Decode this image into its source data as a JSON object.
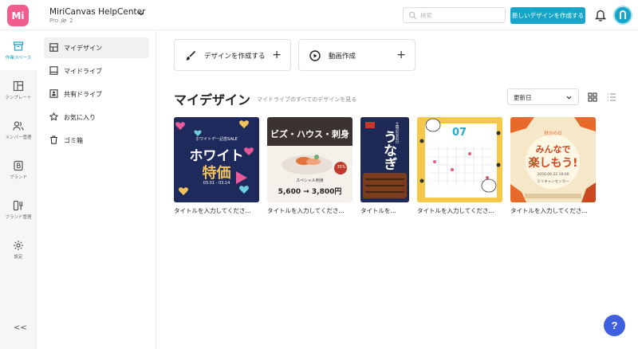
{
  "header": {
    "logo_text": "Mi",
    "workspace_name": "MiriCanvas HelpCenter",
    "workspace_plan": "Pro",
    "member_count": "2",
    "search_placeholder": "検索",
    "create_button": "新しいデザインを作成する"
  },
  "rail": {
    "items": [
      {
        "label": "作業スペース",
        "icon": "workspace-icon"
      },
      {
        "label": "テンプレート",
        "icon": "template-icon"
      },
      {
        "label": "メンバー管理",
        "icon": "members-icon"
      },
      {
        "label": "ブランド",
        "icon": "brand-icon"
      },
      {
        "label": "ブランド管理",
        "icon": "brand-manage-icon"
      },
      {
        "label": "設定",
        "icon": "settings-icon"
      }
    ],
    "collapse": "<<"
  },
  "folders": {
    "items": [
      {
        "label": "マイデザイン"
      },
      {
        "label": "マイドライブ"
      },
      {
        "label": "共有ドライブ"
      },
      {
        "label": "お気に入り"
      },
      {
        "label": "ゴミ箱"
      }
    ]
  },
  "quick_actions": {
    "create_design": "デザインを作成する",
    "video_create": "動画作成",
    "plus": "+"
  },
  "section": {
    "title": "マイデザイン",
    "subtitle": "マイドライブのすべてのデザインを見る",
    "sort_value": "更新日"
  },
  "designs": [
    {
      "title": "タイトルを入力してくださ...",
      "thumb_text_1": "ホワイトデー記念SALE",
      "thumb_text_2": "ホワイト",
      "thumb_text_3": "特価",
      "thumb_text_4": "03.01 - 03.14"
    },
    {
      "title": "タイトルを入力してくださ...",
      "thumb_text_1": "ビズ・ハウス・刺身",
      "thumb_text_2": "スペシャル刺身",
      "thumb_text_3": "5,600 → 3,800円",
      "thumb_text_4": "35%"
    },
    {
      "title": "タイトルを...",
      "thumb_text_1": "土用の丑の日",
      "thumb_text_2": "うなぎ"
    },
    {
      "title": "タイトルを入力してくださ...",
      "thumb_text_1": "07"
    },
    {
      "title": "タイトルを入力してくださ...",
      "thumb_text_1": "秋分の日",
      "thumb_text_2": "みんなで",
      "thumb_text_3": "楽しもう!",
      "thumb_text_4": "2050.09.22 19:00",
      "thumb_text_5": "ミリキャンセンター"
    }
  ],
  "help_label": "?",
  "colors": {
    "accent": "#17a6c9",
    "logo": "#f25d8e",
    "help": "#3d5fe0"
  }
}
